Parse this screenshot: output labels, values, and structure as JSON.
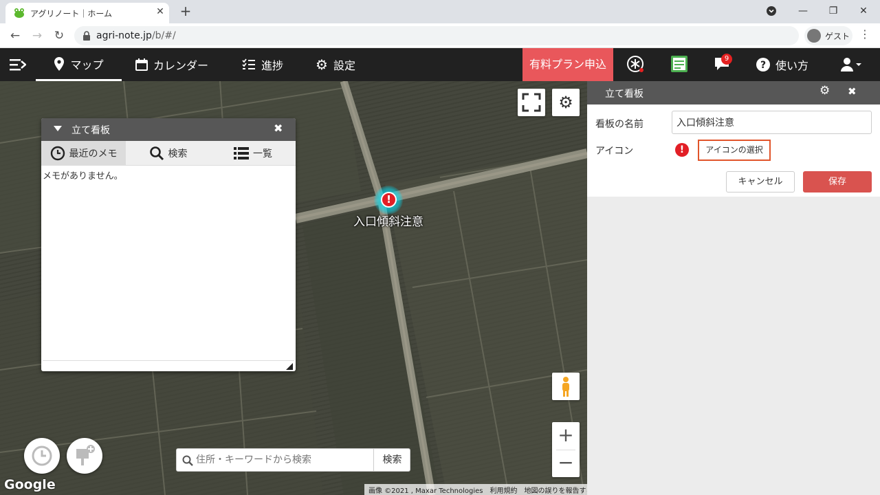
{
  "browser": {
    "tab_title": "アグリノート｜ホーム",
    "url_host": "agri-note.jp",
    "url_path": "/b/#/",
    "profile_label": "ゲスト"
  },
  "appnav": {
    "items": [
      {
        "label": "マップ",
        "icon": "map-pin-icon",
        "active": true
      },
      {
        "label": "カレンダー",
        "icon": "calendar-icon",
        "active": false
      },
      {
        "label": "進捗",
        "icon": "checklist-icon",
        "active": false
      },
      {
        "label": "設定",
        "icon": "gear-icon",
        "active": false
      }
    ],
    "paid_plan_label": "有料プラン申込",
    "notification_count": "9",
    "help_label": "使い方"
  },
  "map": {
    "marker_label": "入口傾斜注意",
    "google_logo": "Google",
    "attribution": {
      "imagery": "画像 ©2021 , Maxar Technologies",
      "terms": "利用規約",
      "report": "地図の誤りを報告する"
    },
    "search": {
      "placeholder": "住所・キーワードから検索",
      "button_label": "検索"
    }
  },
  "memo_panel": {
    "title": "立て看板",
    "tabs": [
      {
        "label": "最近のメモ",
        "icon": "clock-icon",
        "active": true
      },
      {
        "label": "検索",
        "icon": "search-icon",
        "active": false
      },
      {
        "label": "一覧",
        "icon": "list-icon",
        "active": false
      }
    ],
    "empty_message": "メモがありません。"
  },
  "side_panel": {
    "title": "立て看板",
    "name_label": "看板の名前",
    "name_value": "入口傾斜注意",
    "icon_label": "アイコン",
    "icon_select_label": "アイコンの選択",
    "cancel_label": "キャンセル",
    "save_label": "保存"
  },
  "colors": {
    "nav_bg": "#212121",
    "paid_plan": "#e9575b",
    "save_button": "#d9534f",
    "highlight_border": "#e1542a",
    "panel_header": "#575757",
    "marker_red": "#e21f26",
    "marker_glow": "#00e5ff"
  }
}
